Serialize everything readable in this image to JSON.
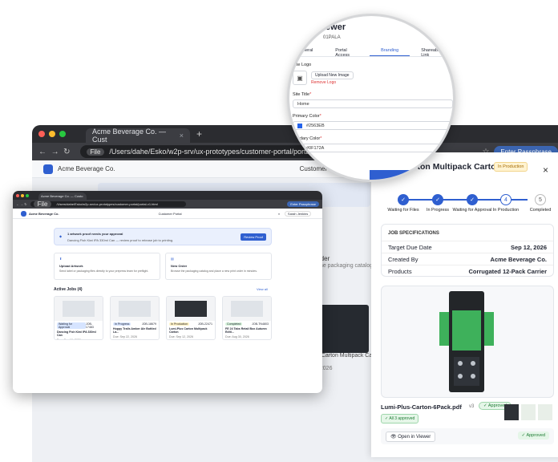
{
  "back": {
    "tab_title": "Acme Beverage Co. — Cust",
    "file_chip": "File",
    "url": "/Users/dahe/Esko/w2p-srv/ux-prototypes/customer-portal/portal-v1.html",
    "passphrase": "Enter Passphrase",
    "company": "Acme Beverage Co.",
    "portal": "Customer Portal",
    "list_title": "Carton Multipack Carton",
    "frag1": "rder",
    "frag2": "the packaging catalog a",
    "frag3": "p Carton Multipack Carton",
    "frag4": ", 2026"
  },
  "mini": {
    "tab_title": "Acme Beverage Co. — Custo",
    "file_chip": "File",
    "url": "/Users/dahe/Esko/w2p-srv/ux-prototypes/customer-portal/portal-v1.html",
    "passphrase": "Enter Passphrase",
    "company": "Acme Beverage Co.",
    "portal": "Customer Portal",
    "user": "Sarah Jenkins",
    "banner_title": "1 artwork proof needs your approval",
    "banner_sub": "Dancing Fish Kiwi IPA 330ml Can — review proof to release job to printing.",
    "review_btn": "Review Proof",
    "upload_title": "Upload Artwork",
    "upload_sub": "Send label or packaging files directly to your prepress team for preflight.",
    "order_title": "New Order",
    "order_sub": "Browse the packaging catalog and place a new print order in minutes.",
    "active_jobs": "Active Jobs (4)",
    "view_all": "View all",
    "jobs": [
      {
        "status": "Waiting for Approval",
        "id": "JOB-17483",
        "name": "Dancing Fish Kiwi IPA 330ml Can",
        "due": "Due: Sep 10, 2026",
        "color": "#d6e4ff"
      },
      {
        "status": "In Progress",
        "id": "JOB-18679",
        "name": "Hoppy Trails Amber Ale Bottled La...",
        "due": "Due: Sep 22, 2026",
        "color": "#d6e4ff"
      },
      {
        "status": "In Production",
        "id": "JOB-22471",
        "name": "Lumi-Plus Carton Multipack Carton",
        "due": "Due: Sep 12, 2026",
        "color": "#fff1c2"
      },
      {
        "status": "Completed",
        "id": "JOB-TN4803",
        "name": "FE 24 Tabs Retail Box Autumn Editi...",
        "due": "Due: Aug 30, 2026",
        "color": "#d8f5dd"
      }
    ]
  },
  "panel": {
    "title": "Carton Multipack Carton",
    "badge": "In Production",
    "sub": "471",
    "close": "×",
    "steps": [
      {
        "label": "Waiting for Files",
        "n": "✓",
        "state": "done"
      },
      {
        "label": "In Progress",
        "n": "✓",
        "state": "done"
      },
      {
        "label": "Waiting for Approval",
        "n": "✓",
        "state": "done"
      },
      {
        "label": "In Production",
        "n": "4",
        "state": "cur"
      },
      {
        "label": "Completed",
        "n": "5",
        "state": "todo"
      }
    ],
    "spec_title": "JOB SPECIFICATIONS",
    "specs": [
      {
        "k": "Target Due Date",
        "v": "Sep 12, 2026"
      },
      {
        "k": "Created By",
        "v": "Acme Beverage Co."
      },
      {
        "k": "Products",
        "v": "Corrugated 12-Pack Carrier"
      }
    ],
    "file_name": "Lumi-Plus-Carton-6Pack.pdf",
    "file_ver": "v3",
    "approved": "Approved",
    "all_approved": "All 3 approved",
    "open_viewer": "Open in Viewer",
    "approved2": "Approved"
  },
  "mag": {
    "title": "iewer",
    "code": "01PALA",
    "tabs": [
      "eneral",
      "Portal Access",
      "Branding",
      "Shareable Link"
    ],
    "active_tab": "Branding",
    "site_logo": "Site Logo",
    "upload_image": "Upload New Image",
    "remove_logo": "Remove Logo",
    "site_title_label": "Site Title",
    "site_title": "Home",
    "primary_label": "Primary Color",
    "primary": "#2563EB",
    "secondary_label": "condary Color",
    "secondary": "#0F172A",
    "required": "*",
    "colors": {
      "primary": "#2563EB",
      "secondary": "#0F172A"
    }
  }
}
